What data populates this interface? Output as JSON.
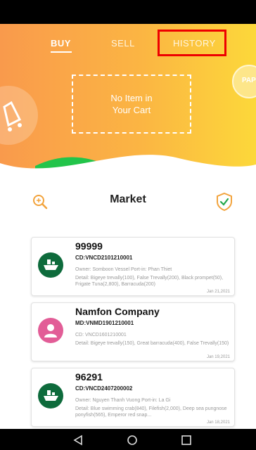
{
  "tabs": {
    "buy": "BUY",
    "sell": "SELL",
    "history": "HISTORY"
  },
  "cart": {
    "line1": "No Item in",
    "line2": "Your Cart"
  },
  "badge": {
    "text": "PAP"
  },
  "market": {
    "title": "Market"
  },
  "colors": {
    "accent_orange": "#f99a4c",
    "accent_yellow": "#fcd83a",
    "highlight_red": "#ee0000",
    "brand_green": "#0e6b3c",
    "avatar_pink": "#e25d97"
  },
  "listings": [
    {
      "title": "99999",
      "code": "CD:VNCD2101210001",
      "line1": "Owner: Somboon Vessel  Port-in: Phan Thiet",
      "line2": "Detail: Bigeye trevally(100), False Trevally(200), Black prompet(50), Frigate Tuna(2,800), Barracuda(200)",
      "date": "Jan 21,2021",
      "avatar_icon": "boat-icon"
    },
    {
      "title": "Namfon Company",
      "code": "MD:VNMD1901210001",
      "line1": "CD: VNCD1601210001",
      "line2": "Detail: Bigeye trevally(150), Great barracuda(400), False Trevally(150)",
      "date": "Jan 19,2021",
      "avatar_icon": "person-icon"
    },
    {
      "title": "96291",
      "code": "CD:VNCD2407200002",
      "line1": "Owner: Nguyen Thanh Vuong  Port-in: La Gi",
      "line2": "Detail: Blue swimming crab(840), Filefish(2,000), Deep sea pungnose ponyfish(565), Emperor red snap...",
      "date": "Jan 18,2021",
      "avatar_icon": "boat-icon"
    }
  ]
}
